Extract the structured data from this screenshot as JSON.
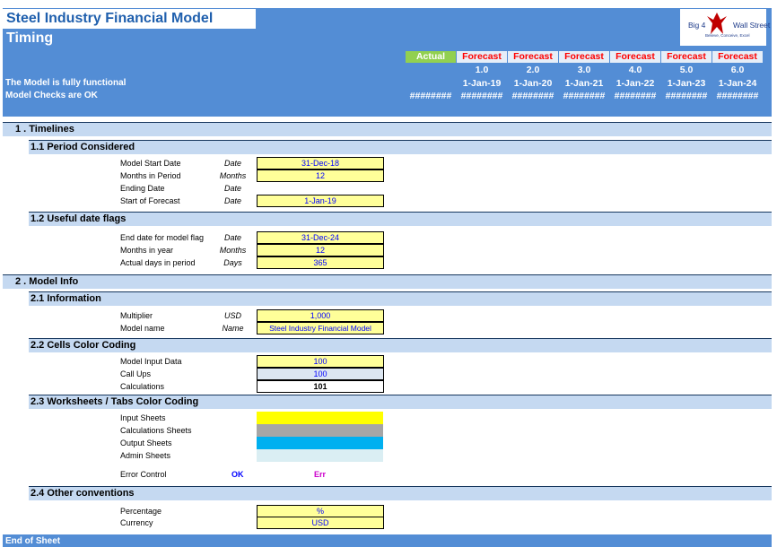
{
  "header": {
    "title": "Steel Industry Financial Model",
    "subtitle": "Timing",
    "status_line1": "The Model is fully functional",
    "status_line2": "Model Checks are OK",
    "logo_text1": "Big 4",
    "logo_text2": "Wall Street",
    "logo_tag": "Believe, Conceive, Excel",
    "columns": [
      {
        "head": "Actual",
        "num": "",
        "date": "",
        "hash": "########"
      },
      {
        "head": "Forecast",
        "num": "1.0",
        "date": "1-Jan-19",
        "hash": "########"
      },
      {
        "head": "Forecast",
        "num": "2.0",
        "date": "1-Jan-20",
        "hash": "########"
      },
      {
        "head": "Forecast",
        "num": "3.0",
        "date": "1-Jan-21",
        "hash": "########"
      },
      {
        "head": "Forecast",
        "num": "4.0",
        "date": "1-Jan-22",
        "hash": "########"
      },
      {
        "head": "Forecast",
        "num": "5.0",
        "date": "1-Jan-23",
        "hash": "########"
      },
      {
        "head": "Forecast",
        "num": "6.0",
        "date": "1-Jan-24",
        "hash": "########"
      }
    ]
  },
  "s1": {
    "title": "1 .  Timelines",
    "a": {
      "title": "1.1  Period Considered",
      "rows": [
        {
          "label": "Model Start Date",
          "unit": "Date",
          "value": "31-Dec-18"
        },
        {
          "label": "Months in Period",
          "unit": "Months",
          "value": "12"
        },
        {
          "label": "Ending Date",
          "unit": "Date",
          "value": ""
        },
        {
          "label": "Start of Forecast",
          "unit": "Date",
          "value": "1-Jan-19"
        }
      ]
    },
    "b": {
      "title": "1.2  Useful date flags",
      "rows": [
        {
          "label": "End date for model flag",
          "unit": "Date",
          "value": "31-Dec-24"
        },
        {
          "label": "Months in year",
          "unit": "Months",
          "value": "12"
        },
        {
          "label": "Actual days in period",
          "unit": "Days",
          "value": "365"
        }
      ]
    }
  },
  "s2": {
    "title": "2 .  Model Info",
    "a": {
      "title": "2.1  Information",
      "rows": [
        {
          "label": "Multiplier",
          "unit": "USD",
          "value": "1,000"
        },
        {
          "label": "Model name",
          "unit": "Name",
          "value": "Steel Industry Financial Model"
        }
      ]
    },
    "b": {
      "title": "2.2  Cells Color Coding",
      "rows": [
        {
          "label": "Model Input Data",
          "value": "100"
        },
        {
          "label": "Call Ups",
          "value": "100"
        },
        {
          "label": "Calculations",
          "value": "101"
        }
      ]
    },
    "c": {
      "title": "2.3  Worksheets / Tabs Color Coding",
      "rows": [
        {
          "label": "Input Sheets",
          "color": "#ffff00"
        },
        {
          "label": "Calculations Sheets",
          "color": "#a6a6a6"
        },
        {
          "label": "Output Sheets",
          "color": "#00b0f0"
        },
        {
          "label": "Admin Sheets",
          "color": "#daeef3"
        }
      ],
      "error_label": "Error Control",
      "ok": "OK",
      "err": "Err"
    },
    "d": {
      "title": "2.4  Other conventions",
      "rows": [
        {
          "label": "Percentage",
          "value": "%"
        },
        {
          "label": "Currency",
          "value": "USD"
        }
      ]
    }
  },
  "footer": {
    "label": "End of Sheet"
  }
}
